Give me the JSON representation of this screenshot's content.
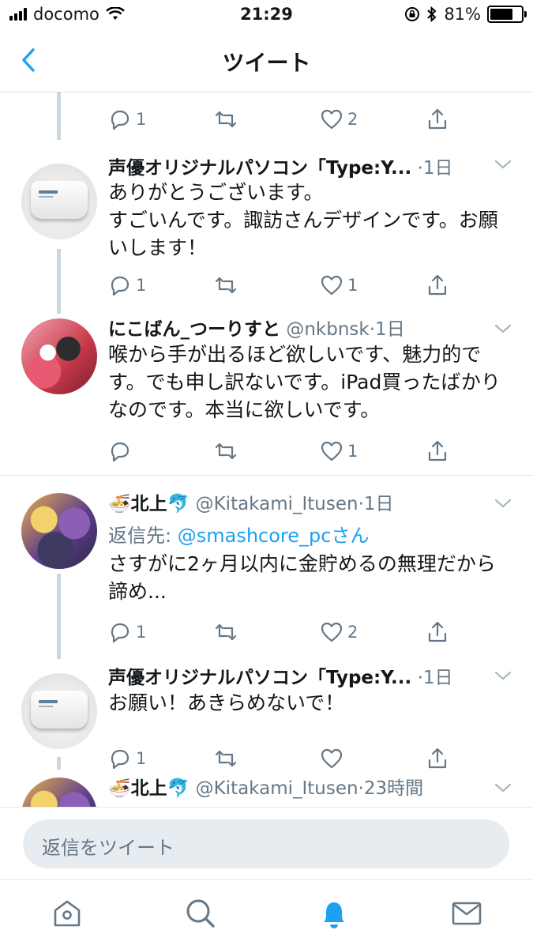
{
  "status_bar": {
    "carrier": "docomo",
    "time": "21:29",
    "battery": "81%",
    "battery_level": 0.81
  },
  "nav": {
    "title": "ツイート",
    "back_icon": "chevron-left-icon"
  },
  "tweets": [
    {
      "actions": {
        "reply": "1",
        "retweet": "",
        "like": "2"
      }
    },
    {
      "name": "声優オリジナルパソコン「Type:Y...",
      "handle": "",
      "time": "·1日",
      "body": "ありがとうございます。\nすごいんです。諏訪さんデザインです。お願いします！",
      "actions": {
        "reply": "1",
        "retweet": "",
        "like": "1"
      }
    },
    {
      "name": "にこばん_つーりすと",
      "handle": "@nkbnsk",
      "time": "·1日",
      "body": "喉から手が出るほど欲しいです、魅力的です。でも申し訳ないです。iPad買ったばかりなのです。本当に欲しいです。",
      "actions": {
        "reply": "",
        "retweet": "",
        "like": "1"
      }
    },
    {
      "name_emoji_left": "🍜",
      "name": "北上",
      "name_emoji_right": "🐬",
      "handle": "@Kitakami_Itusen",
      "time": "·1日",
      "reply_label": "返信先:",
      "reply_target": "@smashcore_pcさん",
      "body": "さすがに2ヶ月以内に金貯めるの無理だから諦め...",
      "actions": {
        "reply": "1",
        "retweet": "",
        "like": "2"
      }
    },
    {
      "name": "声優オリジナルパソコン「Type:Y...",
      "handle": "",
      "time": "·1日",
      "body": "お願い！あきらめないで！",
      "actions": {
        "reply": "1",
        "retweet": "",
        "like": ""
      }
    },
    {
      "name_emoji_left": "🍜",
      "name": "北上",
      "name_emoji_right": "🐬",
      "handle": "@Kitakami_Itusen",
      "time": "·23時間"
    }
  ],
  "compose": {
    "placeholder": "返信をツイート"
  },
  "tabs": [
    {
      "icon": "home-icon",
      "active": false
    },
    {
      "icon": "search-icon",
      "active": false
    },
    {
      "icon": "notifications-icon",
      "active": true
    },
    {
      "icon": "messages-icon",
      "active": false
    }
  ],
  "colors": {
    "accent": "#1da1f2",
    "muted": "#657786",
    "thread_line": "#ccd6dd",
    "compose_bg": "#e6ecf0"
  }
}
